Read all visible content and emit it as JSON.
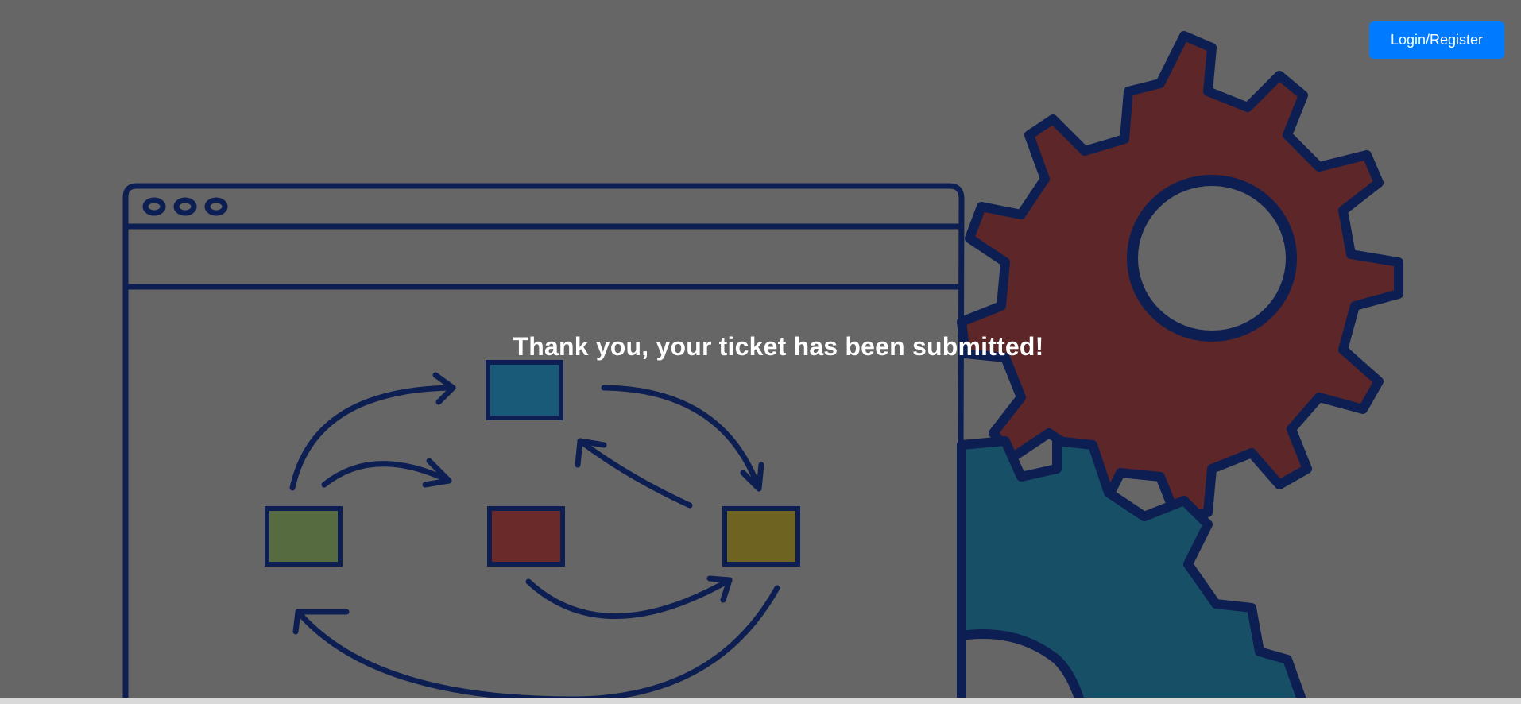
{
  "header": {
    "login_label": "Login/Register"
  },
  "main": {
    "confirmation_message": "Thank you, your ticket has been submitted!"
  },
  "icons": {
    "illustration": "workflow-gears-illustration"
  },
  "colors": {
    "accent": "#007bff",
    "background": "#666666",
    "outline": "#0d1f52",
    "gear_red": "#5d2628",
    "gear_blue": "#174f66",
    "box_blue": "#185a78",
    "box_green": "#566b3f",
    "box_red": "#6a2a2a",
    "box_yellow": "#6f6322"
  }
}
